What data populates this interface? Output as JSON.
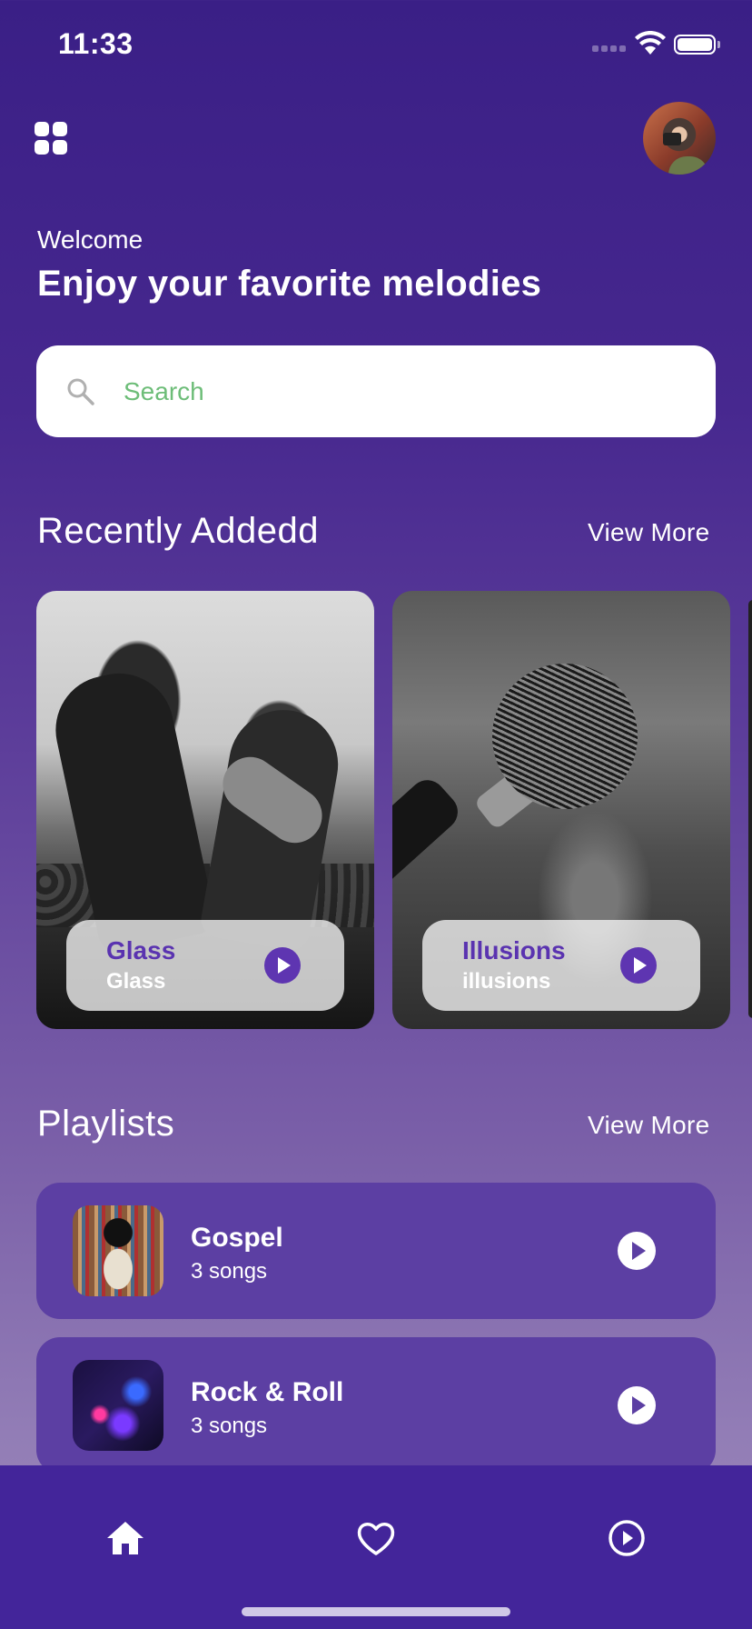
{
  "status_bar": {
    "time": "11:33"
  },
  "header": {
    "menu_icon": "grid-menu-icon",
    "avatar_icon": "user-avatar",
    "welcome": "Welcome",
    "headline": "Enjoy your favorite melodies"
  },
  "search": {
    "placeholder": "Search",
    "value": ""
  },
  "recent": {
    "title": "Recently Addedd",
    "view_more": "View More",
    "cards": [
      {
        "title": "Glass",
        "subtitle": "Glass"
      },
      {
        "title": "Illusions",
        "subtitle": "illusions"
      }
    ]
  },
  "playlists": {
    "title": "Playlists",
    "view_more": "View More",
    "items": [
      {
        "name": "Gospel",
        "count": "3 songs"
      },
      {
        "name": "Rock & Roll",
        "count": "3 songs"
      }
    ]
  },
  "bottom_nav": {
    "items": [
      {
        "icon": "home-icon",
        "active": true
      },
      {
        "icon": "heart-icon",
        "active": false
      },
      {
        "icon": "play-circle-icon",
        "active": false
      }
    ]
  },
  "colors": {
    "accent": "#5e35b1",
    "nav_background": "#43259a",
    "playlist_row": "#5c3fa3",
    "search_placeholder": "#6dbd78"
  }
}
